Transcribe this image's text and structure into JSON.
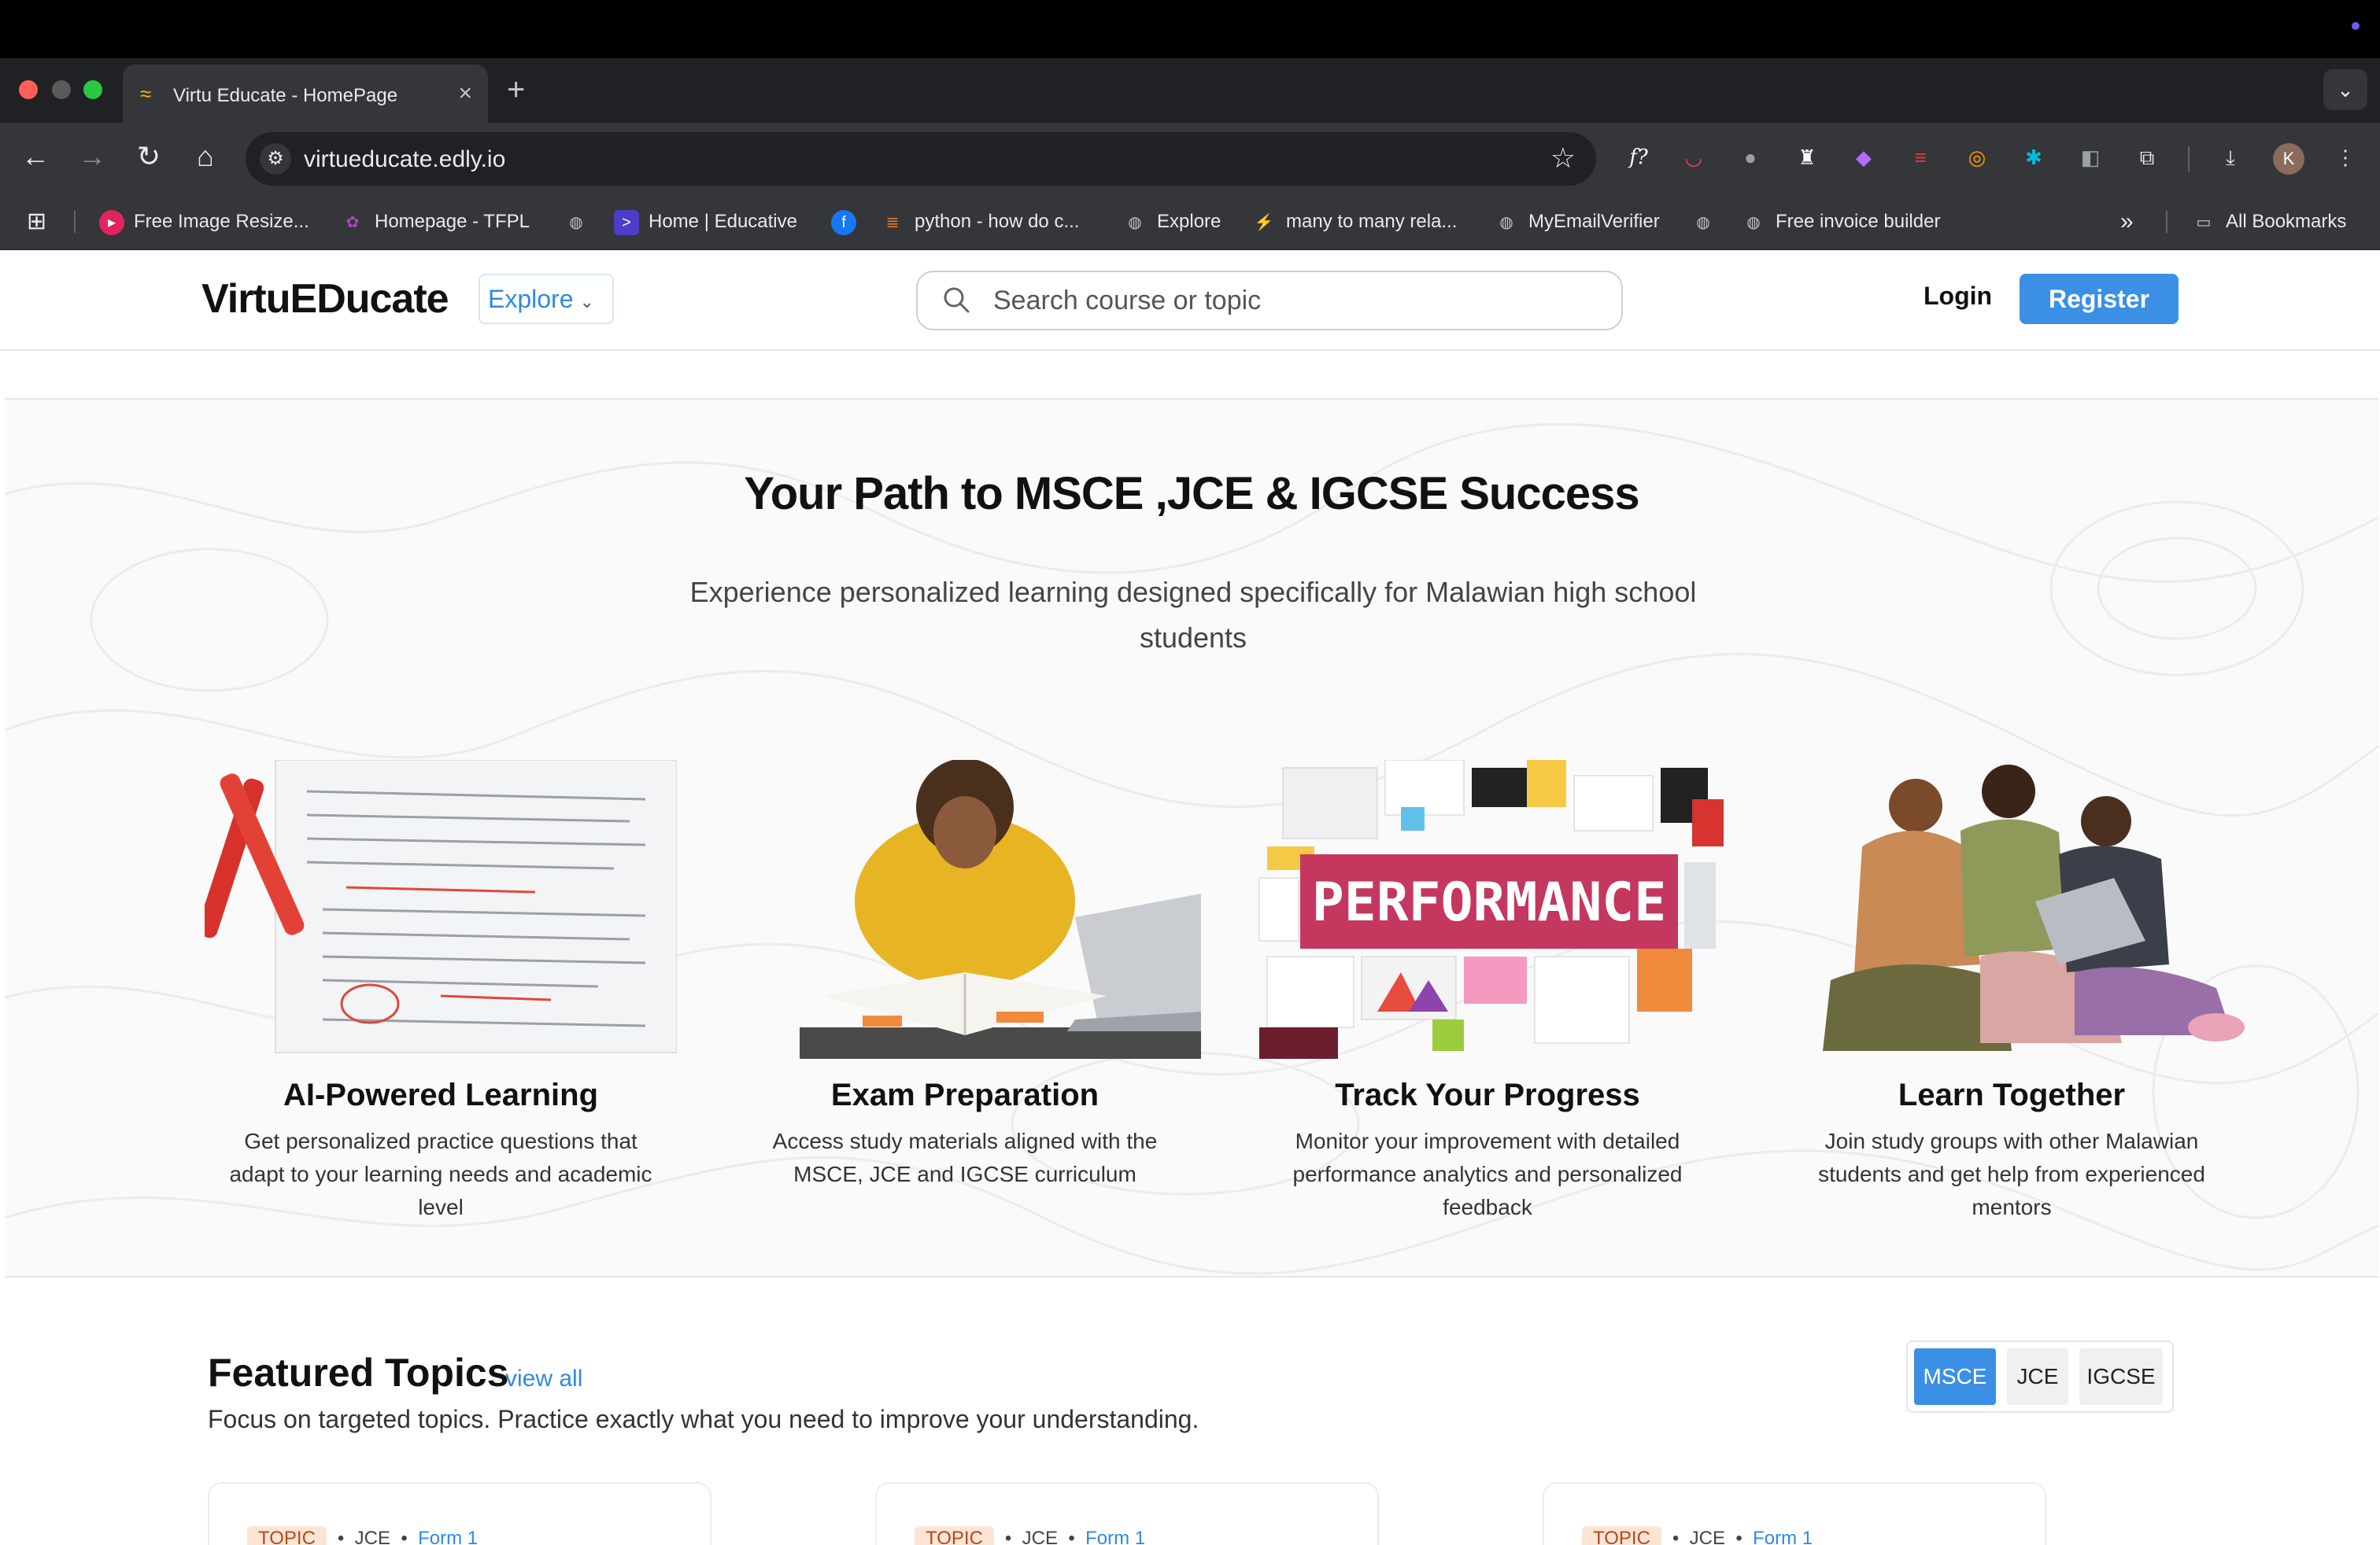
{
  "browser": {
    "tab_title": "Virtu Educate - HomePage",
    "url": "virtueducate.edly.io",
    "avatar_initial": "K",
    "bookmarks": [
      {
        "label": "Free Image Resize...",
        "icon": "resize-icon",
        "color": "#e0245e"
      },
      {
        "label": "Homepage - TFPL",
        "icon": "tfpl-icon",
        "color": "#9c27b0"
      },
      {
        "label": "",
        "icon": "globe-icon",
        "color": "#5f6368"
      },
      {
        "label": "Home | Educative",
        "icon": "educative-icon",
        "color": "#4b3ec9"
      },
      {
        "label": "",
        "icon": "facebook-icon",
        "color": "#1877f2"
      },
      {
        "label": "python - how do c...",
        "icon": "stackoverflow-icon",
        "color": "#f48024"
      },
      {
        "label": "Explore",
        "icon": "globe-icon",
        "color": "#5f6368"
      },
      {
        "label": "many to many rela...",
        "icon": "leaf-icon",
        "color": "#7cb342"
      },
      {
        "label": "MyEmailVerifier",
        "icon": "globe-icon",
        "color": "#5f6368"
      },
      {
        "label": "",
        "icon": "globe-icon",
        "color": "#5f6368"
      },
      {
        "label": "Free invoice builder",
        "icon": "globe-icon",
        "color": "#5f6368"
      }
    ],
    "all_bookmarks": "All Bookmarks",
    "overflow": "»"
  },
  "header": {
    "logo": "VirtuEDucate",
    "explore_label": "Explore",
    "search_placeholder": "Search course or topic",
    "login_label": "Login",
    "register_label": "Register"
  },
  "hero": {
    "title": "Your Path to MSCE ,JCE & IGCSE Success",
    "subtitle": "Experience personalized learning designed specifically for Malawian high school students",
    "features": [
      {
        "title": "AI-Powered Learning",
        "text": "Get personalized practice questions that adapt to your learning needs and academic level"
      },
      {
        "title": "Exam Preparation",
        "text": "Access study materials aligned with the MSCE, JCE and IGCSE curriculum"
      },
      {
        "title": "Track Your Progress",
        "text": "Monitor your improvement with detailed performance analytics and personalized feedback",
        "image_text": "PERFORMANCE"
      },
      {
        "title": "Learn Together",
        "text": "Join study groups with other Malawian students and get help from experienced mentors"
      }
    ]
  },
  "featured": {
    "title": "Featured Topics",
    "view_all": "view all",
    "subtitle": "Focus on targeted topics. Practice exactly what you need to improve your understanding.",
    "tabs": [
      "MSCE",
      "JCE",
      "IGCSE"
    ],
    "active_tab": "MSCE",
    "cards": [
      {
        "tag": "TOPIC",
        "level": "JCE",
        "form": "Form 1"
      },
      {
        "tag": "TOPIC",
        "level": "JCE",
        "form": "Form 1"
      },
      {
        "tag": "TOPIC",
        "level": "JCE",
        "form": "Form 1"
      }
    ]
  },
  "colors": {
    "accent": "#3b8fe4",
    "link": "#2f8ae0"
  }
}
